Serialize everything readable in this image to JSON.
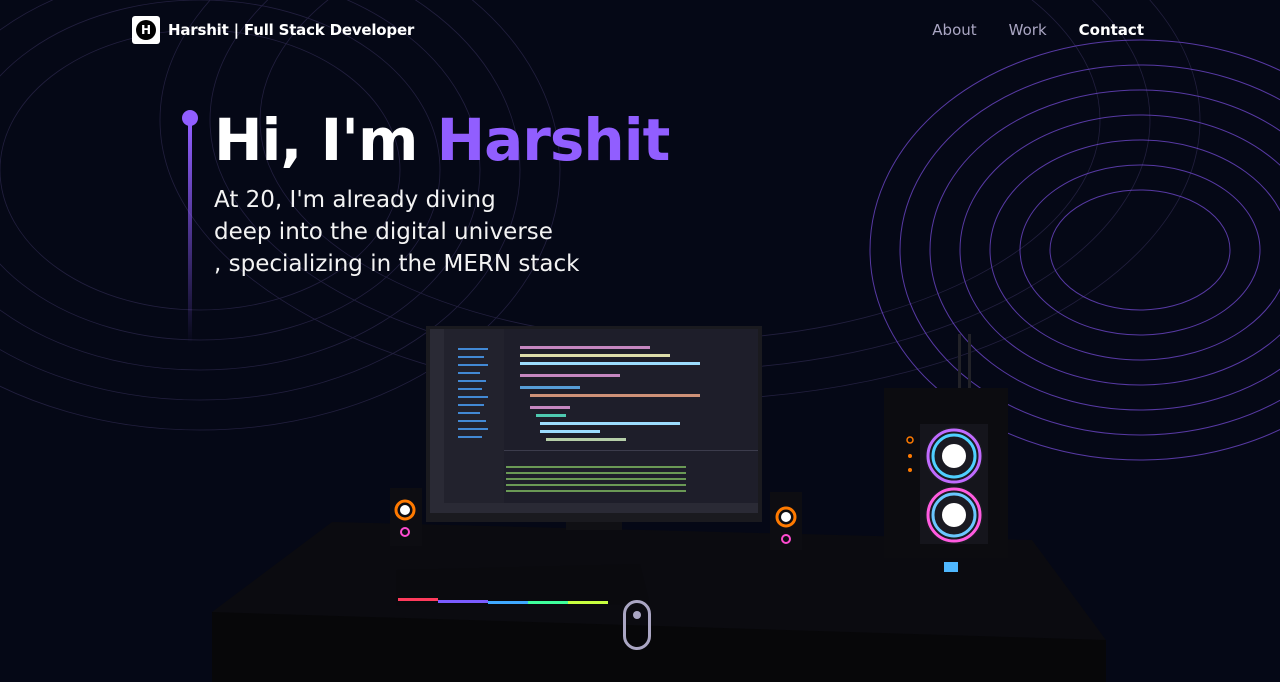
{
  "colors": {
    "background": "#050816",
    "accent": "#915eff",
    "nav_inactive": "#aaa6c3",
    "text": "#ffffff"
  },
  "nav": {
    "logo_letter": "H",
    "brand_name": "Harshit",
    "brand_tagline": "| Full Stack Developer",
    "links": [
      {
        "label": "About",
        "active": false
      },
      {
        "label": "Work",
        "active": false
      },
      {
        "label": "Contact",
        "active": true
      }
    ]
  },
  "hero": {
    "greeting": "Hi, I'm",
    "name": "Harshit",
    "subtitle_lines": [
      "At 20, I'm already diving",
      "deep into the digital universe",
      ", specializing in the MERN stack"
    ]
  },
  "scene": {
    "description_icons": [
      "monitor-icon",
      "keyboard-icon",
      "speaker-icon",
      "pc-tower-icon",
      "desk-icon"
    ]
  },
  "scroll_indicator": {
    "icon": "mouse-scroll-icon"
  }
}
